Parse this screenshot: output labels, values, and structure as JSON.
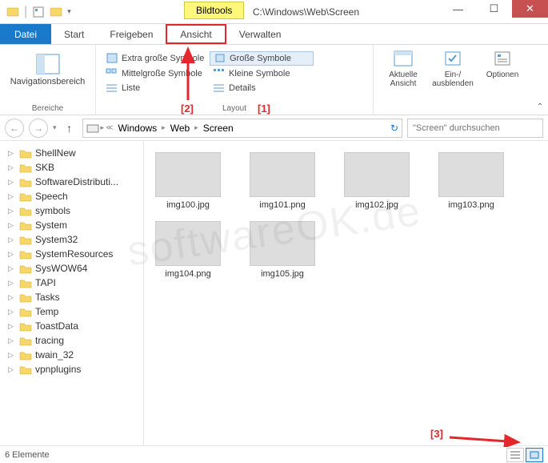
{
  "titlebar": {
    "tool_tab": "Bildtools",
    "path_title": "C:\\Windows\\Web\\Screen"
  },
  "tabs": {
    "file": "Datei",
    "start": "Start",
    "share": "Freigeben",
    "view": "Ansicht",
    "manage": "Verwalten"
  },
  "ribbon": {
    "navpane": "Navigationsbereich",
    "group_panes": "Bereiche",
    "layout_extra_large": "Extra große Symbole",
    "layout_large": "Große Symbole",
    "layout_medium": "Mittelgroße Symbole",
    "layout_small": "Kleine Symbole",
    "layout_list": "Liste",
    "layout_details": "Details",
    "group_layout": "Layout",
    "current_view": "Aktuelle Ansicht",
    "hide": "Ein-/ ausblenden",
    "options": "Optionen"
  },
  "breadcrumb": [
    "Windows",
    "Web",
    "Screen"
  ],
  "search_placeholder": "\"Screen\" durchsuchen",
  "tree": [
    "ShellNew",
    "SKB",
    "SoftwareDistributi...",
    "Speech",
    "symbols",
    "System",
    "System32",
    "SystemResources",
    "SysWOW64",
    "TAPI",
    "Tasks",
    "Temp",
    "ToastData",
    "tracing",
    "twain_32",
    "vpnplugins"
  ],
  "thumbs": [
    {
      "name": "img100.jpg",
      "cls": "t100"
    },
    {
      "name": "img101.png",
      "cls": "t101"
    },
    {
      "name": "img102.jpg",
      "cls": "t102"
    },
    {
      "name": "img103.png",
      "cls": "t103"
    },
    {
      "name": "img104.png",
      "cls": "t104"
    },
    {
      "name": "img105.jpg",
      "cls": "t105"
    }
  ],
  "status": "6 Elemente",
  "annotations": {
    "a1": "[1]",
    "a2": "[2]",
    "a3": "[3]"
  },
  "watermark": "softwareOK.de"
}
